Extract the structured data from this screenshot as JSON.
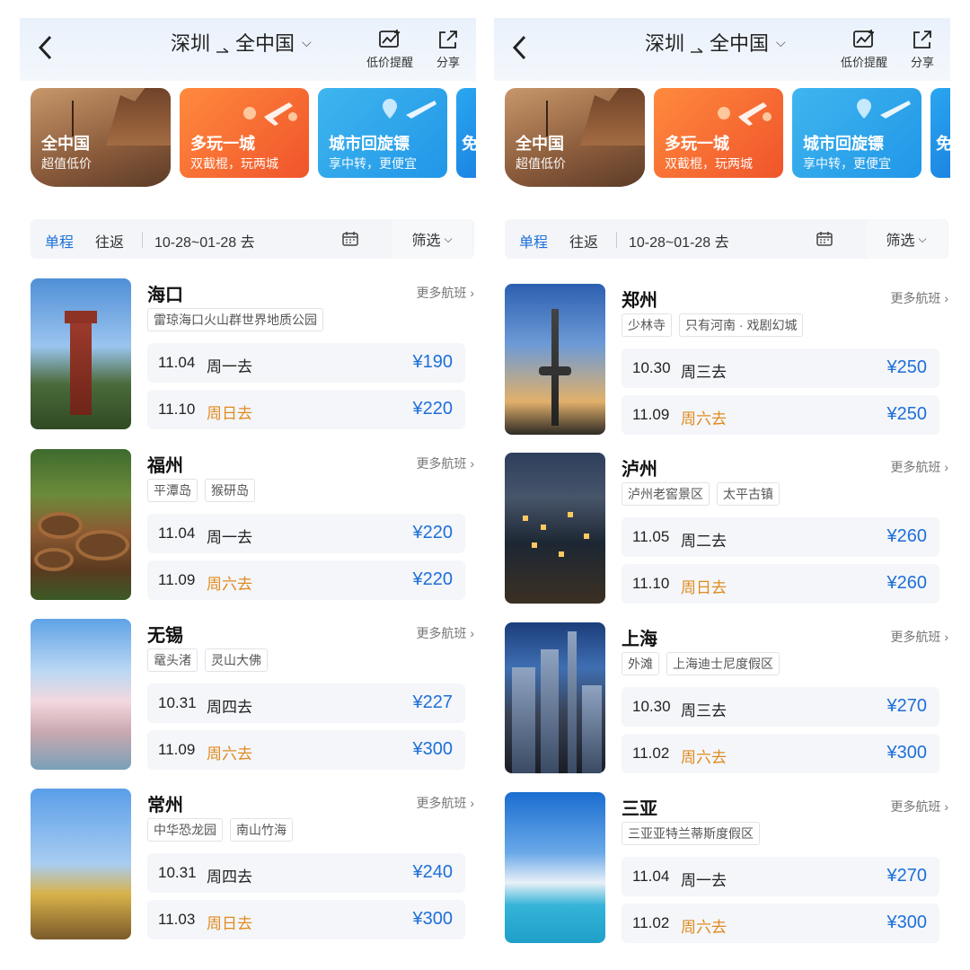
{
  "panels": [
    {
      "header": {
        "origin": "深圳",
        "destination": "全中国",
        "price_alert_label": "低价提醒",
        "share_label": "分享"
      },
      "banners": [
        {
          "title": "全中国",
          "subtitle": "超值低价"
        },
        {
          "title": "多玩一城",
          "subtitle": "双截棍，玩两城"
        },
        {
          "title": "城市回旋镖",
          "subtitle": "享中转，更便宜"
        },
        {
          "title": "免"
        }
      ],
      "tabs": {
        "single": "单程",
        "round": "往返",
        "date_range": "10-28~01-28 去",
        "filter": "筛选"
      },
      "more_flights": "更多航班",
      "cards": [
        {
          "city": "海口",
          "tags": [
            "雷琼海口火山群世界地质公园"
          ],
          "rows": [
            {
              "date": "11.04",
              "weekday": "周一去",
              "price": "¥190",
              "weekend": false
            },
            {
              "date": "11.10",
              "weekday": "周日去",
              "price": "¥220",
              "weekend": true
            }
          ]
        },
        {
          "city": "福州",
          "tags": [
            "平潭岛",
            "猴研岛"
          ],
          "rows": [
            {
              "date": "11.04",
              "weekday": "周一去",
              "price": "¥220",
              "weekend": false
            },
            {
              "date": "11.09",
              "weekday": "周六去",
              "price": "¥220",
              "weekend": true
            }
          ]
        },
        {
          "city": "无锡",
          "tags": [
            "鼋头渚",
            "灵山大佛"
          ],
          "rows": [
            {
              "date": "10.31",
              "weekday": "周四去",
              "price": "¥227",
              "weekend": false
            },
            {
              "date": "11.09",
              "weekday": "周六去",
              "price": "¥300",
              "weekend": true
            }
          ]
        },
        {
          "city": "常州",
          "tags": [
            "中华恐龙园",
            "南山竹海"
          ],
          "rows": [
            {
              "date": "10.31",
              "weekday": "周四去",
              "price": "¥240",
              "weekend": false
            },
            {
              "date": "11.03",
              "weekday": "周日去",
              "price": "¥300",
              "weekend": true
            }
          ]
        }
      ]
    },
    {
      "header": {
        "origin": "深圳",
        "destination": "全中国",
        "price_alert_label": "低价提醒",
        "share_label": "分享"
      },
      "banners": [
        {
          "title": "全中国",
          "subtitle": "超值低价"
        },
        {
          "title": "多玩一城",
          "subtitle": "双截棍，玩两城"
        },
        {
          "title": "城市回旋镖",
          "subtitle": "享中转，更便宜"
        },
        {
          "title": "免"
        }
      ],
      "tabs": {
        "single": "单程",
        "round": "往返",
        "date_range": "10-28~01-28 去",
        "filter": "筛选"
      },
      "more_flights": "更多航班",
      "cards": [
        {
          "city": "郑州",
          "tags": [
            "少林寺",
            "只有河南 · 戏剧幻城"
          ],
          "rows": [
            {
              "date": "10.30",
              "weekday": "周三去",
              "price": "¥250",
              "weekend": false
            },
            {
              "date": "11.09",
              "weekday": "周六去",
              "price": "¥250",
              "weekend": true
            }
          ]
        },
        {
          "city": "泸州",
          "tags": [
            "泸州老窖景区",
            "太平古镇"
          ],
          "rows": [
            {
              "date": "11.05",
              "weekday": "周二去",
              "price": "¥260",
              "weekend": false
            },
            {
              "date": "11.10",
              "weekday": "周日去",
              "price": "¥260",
              "weekend": true
            }
          ]
        },
        {
          "city": "上海",
          "tags": [
            "外滩",
            "上海迪士尼度假区"
          ],
          "rows": [
            {
              "date": "10.30",
              "weekday": "周三去",
              "price": "¥270",
              "weekend": false
            },
            {
              "date": "11.02",
              "weekday": "周六去",
              "price": "¥300",
              "weekend": true
            }
          ]
        },
        {
          "city": "三亚",
          "tags": [
            "三亚亚特兰蒂斯度假区"
          ],
          "rows": [
            {
              "date": "11.04",
              "weekday": "周一去",
              "price": "¥270",
              "weekend": false
            },
            {
              "date": "11.02",
              "weekday": "周六去",
              "price": "¥300",
              "weekend": true
            }
          ]
        }
      ]
    }
  ],
  "colors": {
    "accent": "#1e6fd9",
    "weekend": "#e08a1e",
    "orange_banner": "#f0542b",
    "blue_banner": "#2196e8"
  },
  "icons": [
    "back-arrow-icon",
    "price-alert-icon",
    "share-icon",
    "calendar-icon",
    "chevron-down-icon",
    "chevron-right-icon",
    "airplane-icon",
    "location-pin-icon"
  ]
}
